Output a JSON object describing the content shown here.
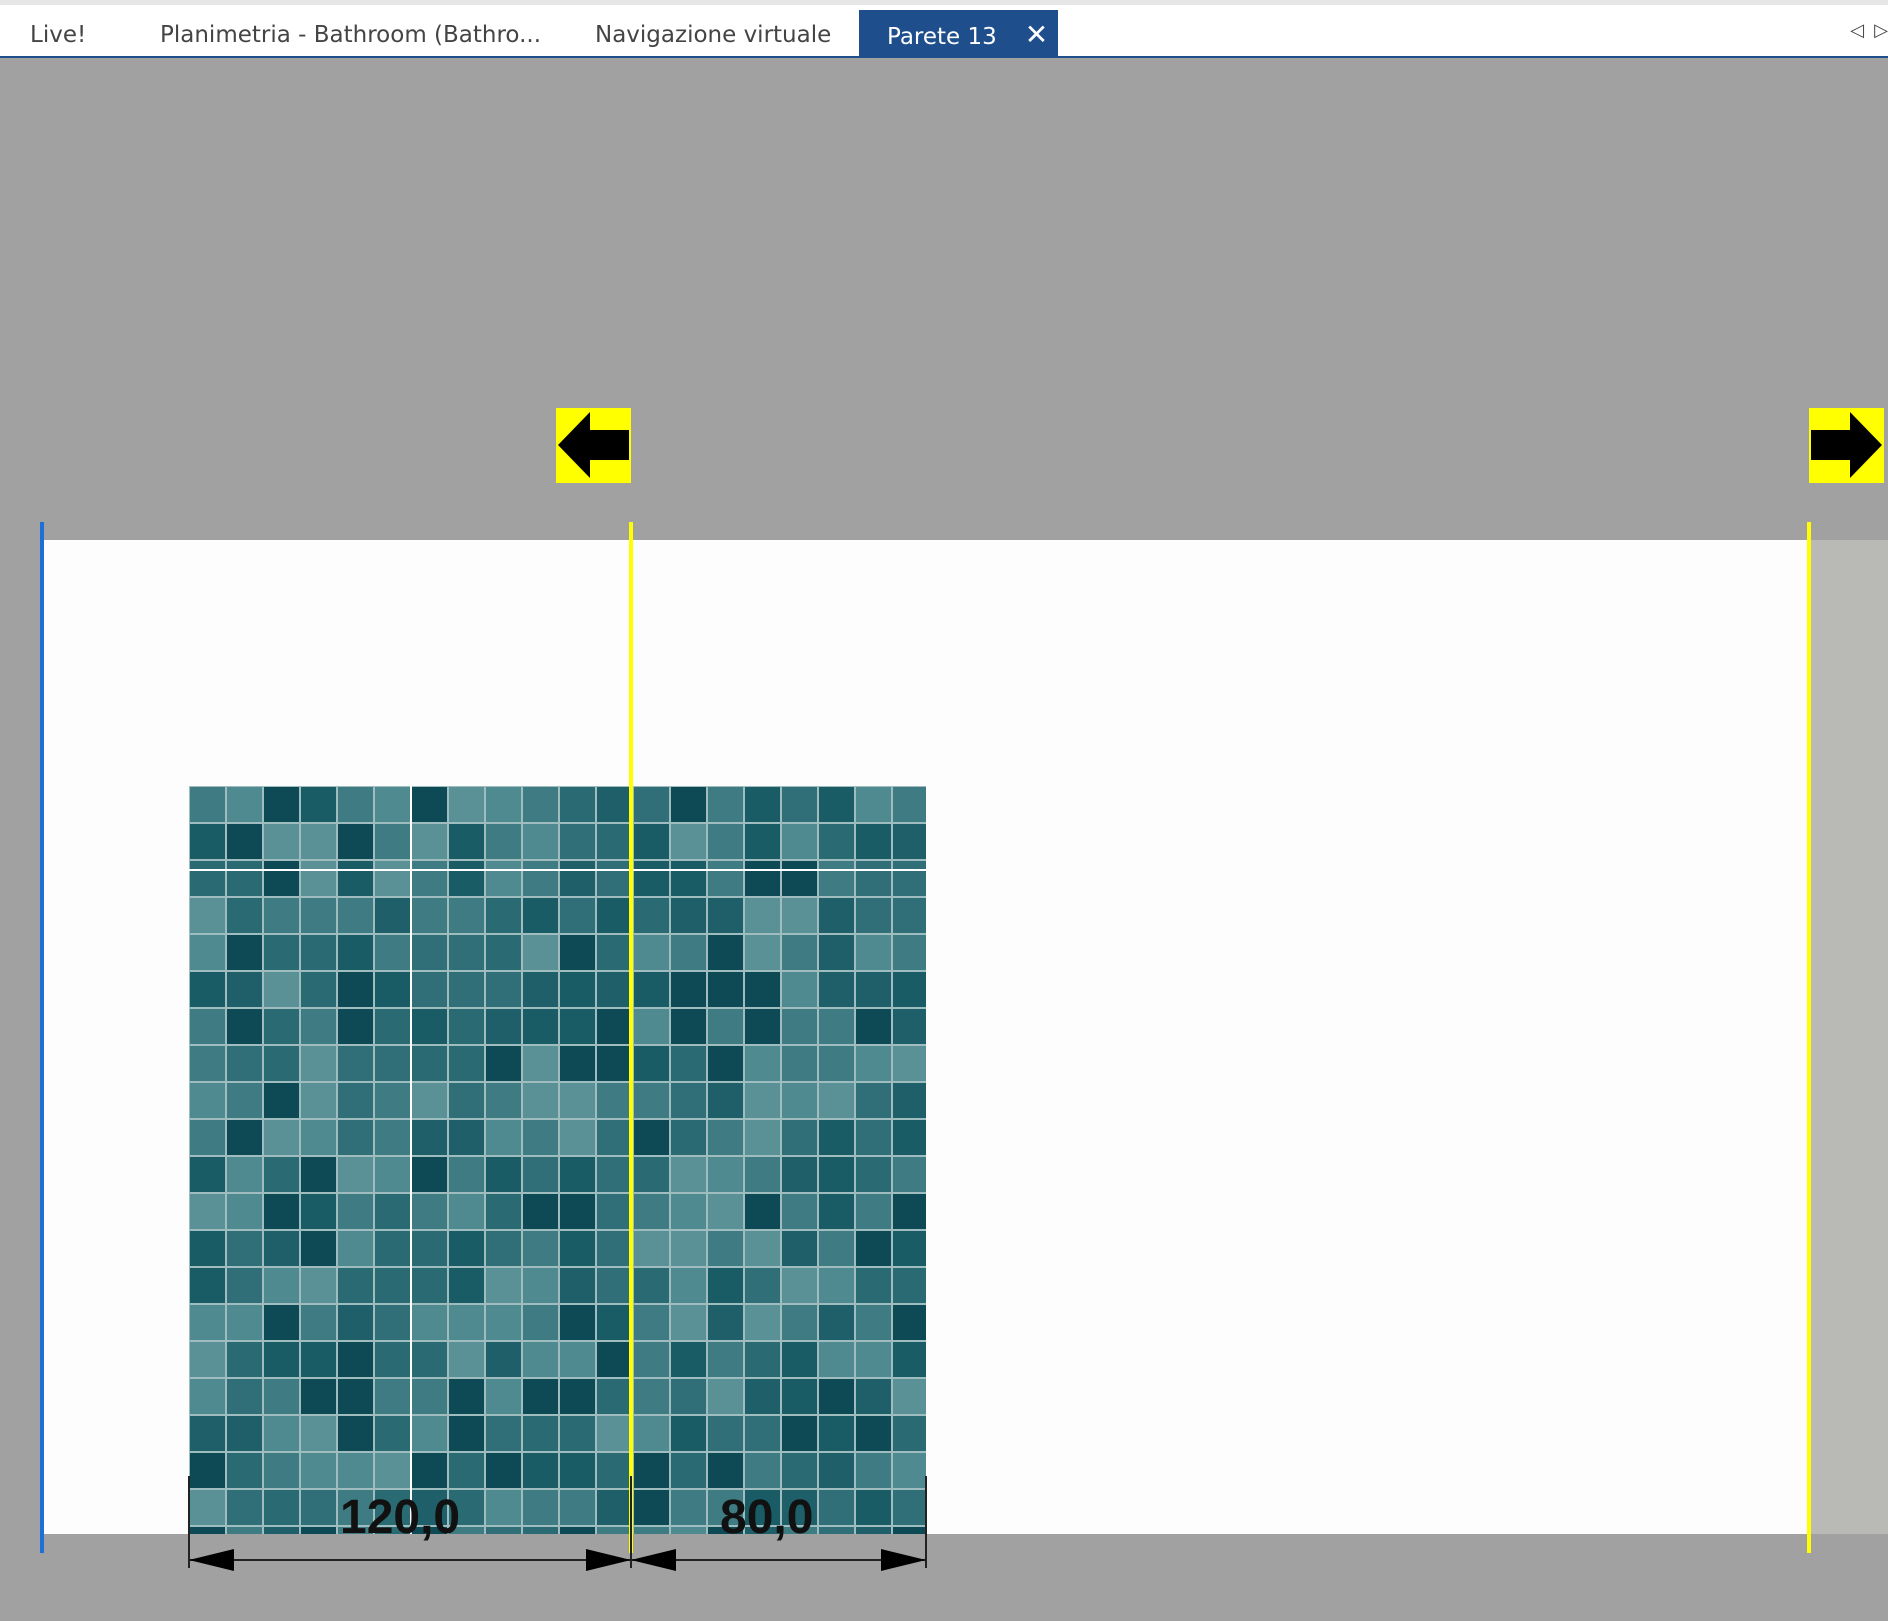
{
  "tabs": [
    {
      "label": "Live!",
      "active": false
    },
    {
      "label": "Planimetria - Bathroom (Bathro...",
      "active": false
    },
    {
      "label": "Navigazione virtuale",
      "active": false
    },
    {
      "label": "Parete 13",
      "active": true
    }
  ],
  "nav": {
    "prev_icon": "◁",
    "next_icon": "▷"
  },
  "close_icon": "✕",
  "dimensions": {
    "left": "120,0",
    "right": "80,0"
  },
  "colors": {
    "accent": "#1e4e8c",
    "guide": "#ffff00",
    "wall_edge": "#1e6fd6",
    "tile_dark": "#0d4a55",
    "tile_light": "#4f8a90"
  }
}
